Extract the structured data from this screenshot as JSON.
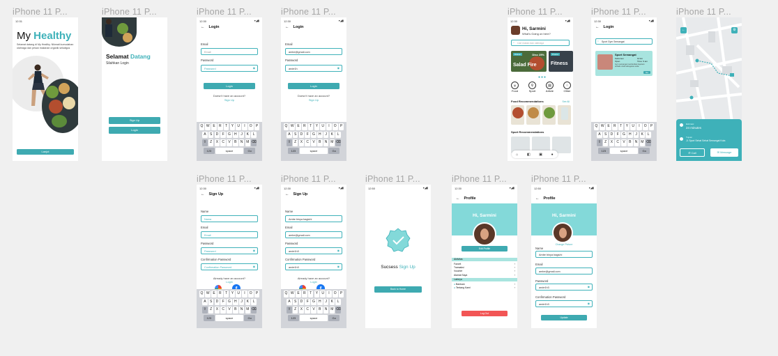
{
  "frame_label": "iPhone 11 P...",
  "time": "12:30",
  "time_alt": "12:50",
  "time_short": "12:31",
  "status_icons": "▾◢▮",
  "splash": {
    "title_prefix": "My",
    "title_accent": "Healthy",
    "description": "Selamat datang di My Healthy. Nikmati kumudahan olahraga dan pesan makanan organik sekaligus",
    "button": "Lanjut"
  },
  "welcome": {
    "greet": "Selamat",
    "greet_accent": "Datang",
    "subtitle": "Silahkan Login",
    "signup_btn": "Sign Up",
    "login_btn": "Login"
  },
  "login": {
    "title": "Login",
    "email_label": "Email",
    "email_placeholder": "Email",
    "email_value": "ambe@gmail.com",
    "password_label": "Password",
    "password_placeholder": "Password",
    "password_value": "ande1h",
    "button": "Login",
    "no_account": "Doesn't have an account?",
    "signup_link": "Sign Up"
  },
  "signup": {
    "title": "Sign Up",
    "name_label": "Name",
    "name_placeholder": "Nama",
    "name_value": "Ambe binya bagiuhi",
    "email_label": "Email",
    "email_placeholder": "Email",
    "email_value": "ambe@gmail.com",
    "password_label": "Password",
    "password_placeholder": "Password",
    "password_value": "ande1h3",
    "confirm_label": "Confirmation Password",
    "confirm_placeholder": "Confirmation Password",
    "confirm_value": "ande1h3",
    "have_account": "Already have an account?",
    "login_link": "Login"
  },
  "keyboard": {
    "row1": [
      "Q",
      "W",
      "E",
      "R",
      "T",
      "Y",
      "U",
      "I",
      "O",
      "P"
    ],
    "row2": [
      "A",
      "S",
      "D",
      "F",
      "G",
      "H",
      "J",
      "K",
      "L"
    ],
    "row3": [
      "Z",
      "X",
      "C",
      "V",
      "B",
      "N",
      "M"
    ],
    "shift": "⇧",
    "del": "⌫",
    "num": "123",
    "space": "space",
    "go": "Go"
  },
  "success": {
    "text": "Sucsess",
    "accent": "Sign Up",
    "button": "Back to Home"
  },
  "home": {
    "greeting": "Hi, Sarmini",
    "subtitle": "What's Going on here?",
    "search_placeholder": "Cari makan dan olahraga",
    "banner1_tag": "Diskon",
    "banner1_badge": "Disc 25%",
    "banner1_title": "Salad Fire",
    "banner2_title": "Fitness",
    "banner2_tag": "Promo",
    "categories": [
      "Food",
      "Sport",
      "Article",
      "Other"
    ],
    "food_section": "Food Recommendations",
    "see_all": "See All",
    "sport_section": "Sport Recommendations"
  },
  "search": {
    "title": "Login",
    "query": "Sport Gym Semangat",
    "card_title": "Sport Semangat",
    "card_line1": "Kebumen",
    "card_line2": "10 km",
    "card_line3": "Open",
    "card_line4": "Time: 9 am",
    "card_desc": "Gym semangat memberikan layanan terbaik untuk kebugaran anda",
    "card_button": "Go"
  },
  "map": {
    "time": "24 minutes",
    "distance_label": "Estimasi",
    "address_label": "Tujuan",
    "address": "Jl. Sport Sehat Sehat Semangat Kota",
    "call": "Call",
    "message": "Message"
  },
  "profile": {
    "title": "Profile",
    "greeting": "Hi, Sarmini",
    "edit_button": "Edit Profile",
    "section_aktivitas": "Aktivitas",
    "menu": [
      "Favorit",
      "Transaksi",
      "Voucher",
      "Alamat Saya"
    ],
    "section_lainnya": "Lainnya",
    "menu2": [
      "Bantuan",
      "Tentang Kami"
    ],
    "logout": "Log Out"
  },
  "edit_profile": {
    "title": "Profile",
    "greeting": "Hi, Sarmini",
    "change_picture": "Change Picture",
    "name_label": "Name",
    "name_value": "Ambe binya bagiuhi",
    "email_label": "Email",
    "email_value": "ambe@gmail.com",
    "password_label": "Password",
    "password_value": "ande1h3",
    "confirm_label": "Confirmation Password",
    "confirm_value": "ande1h3",
    "button": "Update"
  },
  "colors": {
    "accent": "#3eb1b9",
    "accent_light": "#83d9d9",
    "danger": "#f25555"
  }
}
